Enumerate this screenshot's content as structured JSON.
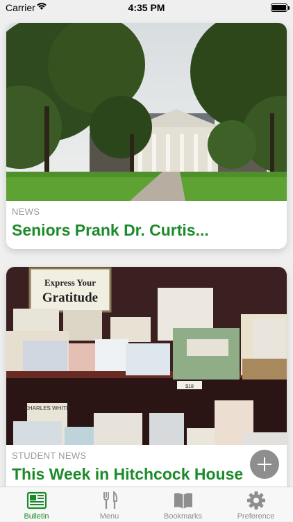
{
  "status_bar": {
    "carrier": "Carrier",
    "time": "4:35 PM"
  },
  "feed": {
    "cards": [
      {
        "category": "NEWS",
        "headline": "Seniors Prank Dr. Curtis..."
      },
      {
        "category": "STUDENT NEWS",
        "headline": "This Week in Hitchcock House",
        "photo_text": {
          "sign_line1": "Express Your",
          "sign_line2": "Gratitude",
          "price_tag": "$18",
          "book_title": "CHARLES WHITE"
        }
      }
    ]
  },
  "tabs": [
    {
      "label": "Bulletin",
      "icon": "newspaper-icon",
      "active": true
    },
    {
      "label": "Menu",
      "icon": "fork-knife-icon",
      "active": false
    },
    {
      "label": "Bookmarks",
      "icon": "book-icon",
      "active": false
    },
    {
      "label": "Preference",
      "icon": "gear-icon",
      "active": false
    }
  ],
  "colors": {
    "accent": "#1c8a2b",
    "inactive": "#8e8e8e",
    "category": "#9a9a9a"
  }
}
